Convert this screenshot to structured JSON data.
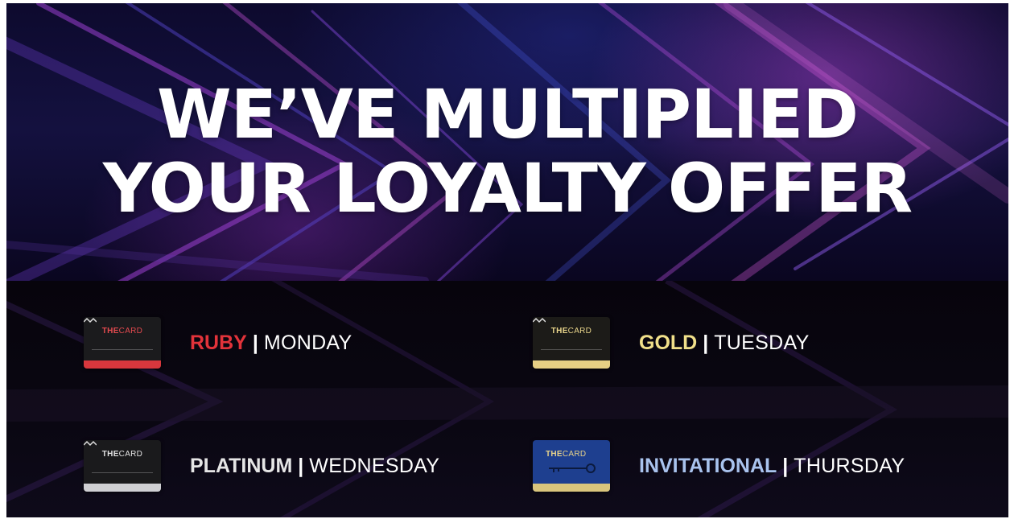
{
  "headline": {
    "line1": "WE’VE MULTIPLIED",
    "line2": "YOUR LOYALTY OFFER"
  },
  "card_brand": {
    "bold": "THE",
    "rest": "CARD"
  },
  "separator": "|",
  "tiers": [
    {
      "name": "RUBY",
      "day": "MONDAY",
      "name_color": "#e2333a",
      "card_color": "#1b1b1d",
      "stripe_color": "#d8373d",
      "logo_color": "#e34a4f"
    },
    {
      "name": "GOLD",
      "day": "TUESDAY",
      "name_color": "#f1e08a",
      "card_color": "#1c1b18",
      "stripe_color": "#e6cf84",
      "logo_color": "#e9d58b"
    },
    {
      "name": "PLATINUM",
      "day": "WEDNESDAY",
      "name_color": "#e6e6e6",
      "card_color": "#1a1a1c",
      "stripe_color": "#cfcfd3",
      "logo_color": "#e2e2e2"
    },
    {
      "name": "INVITATIONAL",
      "day": "THURSDAY",
      "name_color": "#a9c3ee",
      "card_color": "#1e3f8f",
      "stripe_color": "#d9c57d",
      "logo_color": "#e7d28a"
    }
  ]
}
